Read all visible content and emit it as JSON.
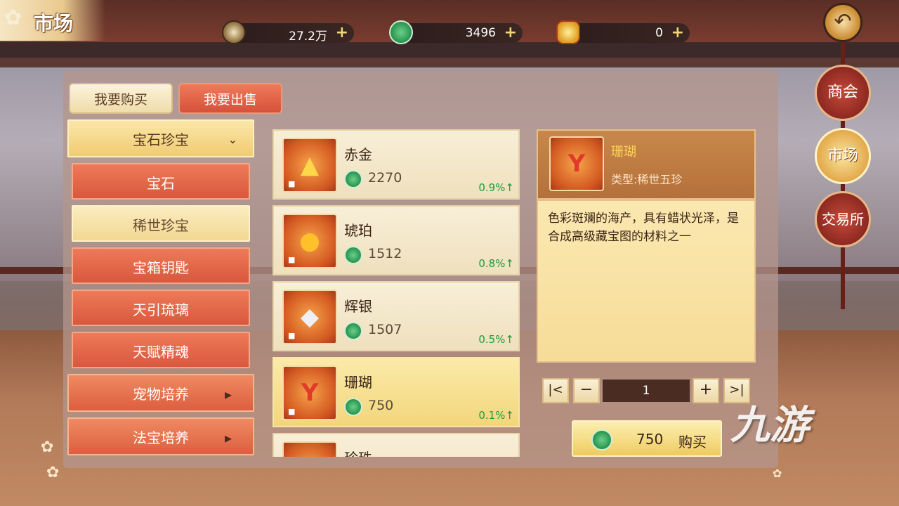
{
  "header": {
    "title": "市场",
    "back_icon": "back-arrow-icon",
    "resources": [
      {
        "name": "copper-coin",
        "value": "27.2万"
      },
      {
        "name": "jade-coin",
        "value": "3496"
      },
      {
        "name": "gold-ingot",
        "value": "0"
      }
    ],
    "plus_glyph": "+"
  },
  "side_nav": [
    {
      "label": "商会",
      "active": false
    },
    {
      "label": "市场",
      "active": true
    },
    {
      "label": "交易所",
      "active": false
    }
  ],
  "tabs": {
    "buy": "我要购买",
    "sell": "我要出售"
  },
  "categories": {
    "group_1": "宝石珍宝",
    "subs": [
      "宝石",
      "稀世珍宝",
      "宝箱钥匙",
      "天引琉璃",
      "天赋精魂"
    ],
    "selected_sub": "稀世珍宝",
    "group_2": "宠物培养",
    "group_3": "法宝培养"
  },
  "items": [
    {
      "name": "赤金",
      "price": "2270",
      "trend": "0.9%",
      "icon": "gold-ingot-icon",
      "glyph": "▲"
    },
    {
      "name": "琥珀",
      "price": "1512",
      "trend": "0.8%",
      "icon": "amber-icon",
      "glyph": "●"
    },
    {
      "name": "辉银",
      "price": "1507",
      "trend": "0.5%",
      "icon": "silver-crystal-icon",
      "glyph": "◆"
    },
    {
      "name": "珊瑚",
      "price": "750",
      "trend": "0.1%",
      "icon": "coral-icon",
      "glyph": "Y"
    },
    {
      "name": "珍珠",
      "price": "",
      "trend": "",
      "icon": "pearl-icon",
      "glyph": "○"
    }
  ],
  "detail": {
    "name": "珊瑚",
    "type": "类型:稀世五珍",
    "description": "色彩斑斓的海产，具有蜡状光泽，是合成高级藏宝图的材料之一"
  },
  "quantity": {
    "value": "1",
    "first": "|<",
    "minus": "−",
    "plus": "+",
    "last": ">|"
  },
  "buy": {
    "price": "750",
    "label": "购买"
  },
  "watermark": "九游"
}
